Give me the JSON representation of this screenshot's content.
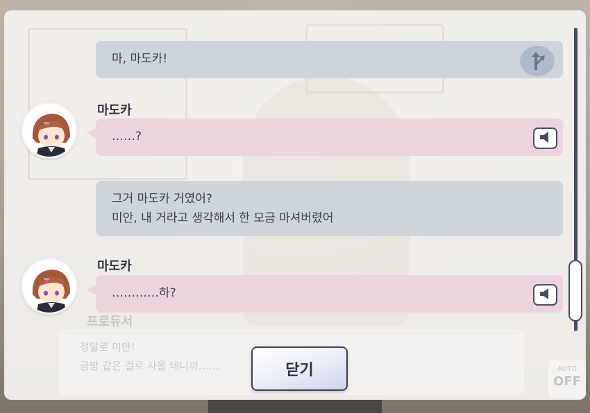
{
  "background": {
    "speaker_name": "프로듀서",
    "lines": [
      "정말로 미안!",
      "금방 같은 걸로 사올 테니까……"
    ],
    "auto_label": "AUTO",
    "auto_state": "OFF"
  },
  "log": [
    {
      "speaker": "",
      "text_lines": [
        "마, 마도카!"
      ],
      "type": "self",
      "action_icon": "branch-icon"
    },
    {
      "speaker": "마도카",
      "text_lines": [
        "……?"
      ],
      "type": "other",
      "action_icon": "voice-icon"
    },
    {
      "speaker": "",
      "text_lines": [
        "그거 마도카 거였어?",
        "미안, 내 거라고 생각해서 한 모금 마셔버렸어"
      ],
      "type": "self"
    },
    {
      "speaker": "마도카",
      "text_lines": [
        "…………하?"
      ],
      "type": "other",
      "action_icon": "voice-icon"
    }
  ],
  "close_label": "닫기",
  "colors": {
    "self_bubble": "#cdd4dc",
    "other_bubble": "#ecd4df",
    "text": "#3e3e4c",
    "outline": "#4a4c5c"
  }
}
